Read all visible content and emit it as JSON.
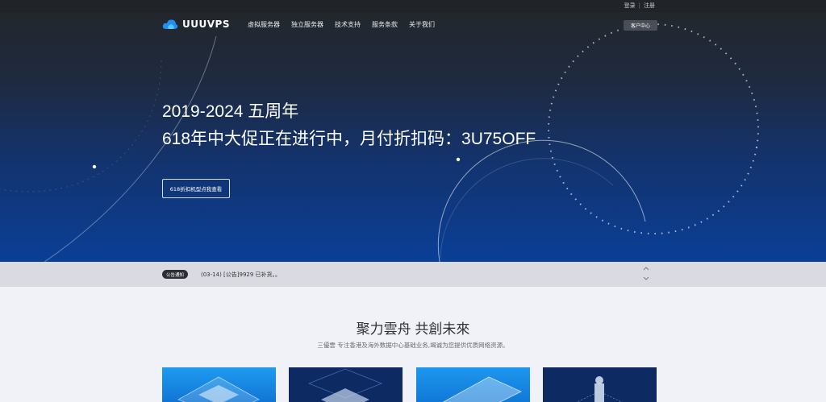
{
  "topbar": {
    "login": "登录",
    "separator": "|",
    "register": "注册"
  },
  "brand": {
    "name": "UUUVPS"
  },
  "nav": {
    "items": [
      "虚拟服务器",
      "独立服务器",
      "技术支持",
      "服务条款",
      "关于我们"
    ],
    "client_center": "客户中心"
  },
  "hero": {
    "line1": "2019-2024 五周年",
    "line2": "618年中大促正在进行中，月付折扣码：3U75OFF",
    "button": "618折扣机型点我查看"
  },
  "notice": {
    "badge": "公告通知",
    "message": "(03-14) [公告]9929 已补货。。",
    "up": "^",
    "down": "⌄"
  },
  "section": {
    "title": "聚力雲舟 共創未來",
    "subtitle": "三優雲 专注香港及海外数据中心基础业务,竭诚为您提供优质网络资源。"
  },
  "colors": {
    "hero_top": "#23272c",
    "hero_bottom": "#0a3f96",
    "card_light": "#1a8be0",
    "card_dark": "#0d2a63"
  },
  "icons": [
    "cloud-logo-icon",
    "chevron-up-icon",
    "chevron-down-icon"
  ]
}
